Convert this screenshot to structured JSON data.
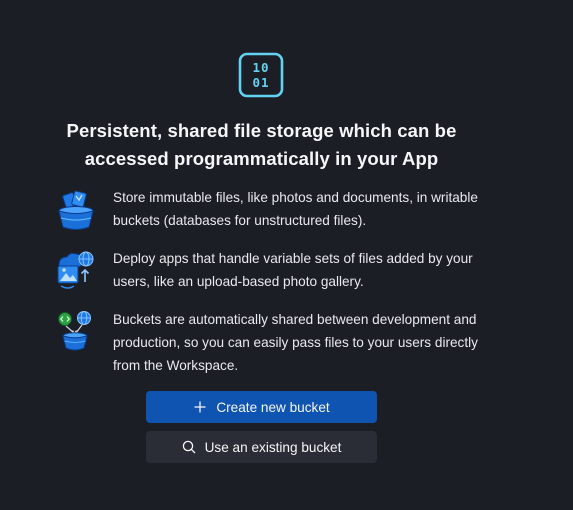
{
  "hero": {
    "icon": "binary-storage-icon",
    "glyph_rows": [
      "10",
      "01"
    ],
    "accent_color": "#62d2f1"
  },
  "title": "Persistent, shared file storage which can be accessed programmatically in your App",
  "features": [
    {
      "icon": "bucket-files-icon",
      "text": "Store immutable files, like photos and documents, in writable buckets (databases for unstructured files)."
    },
    {
      "icon": "upload-gallery-icon",
      "text": "Deploy apps that handle variable sets of files added by your users, like an upload-based photo gallery."
    },
    {
      "icon": "shared-bucket-icon",
      "text": "Buckets are automatically shared between development and production, so you can easily pass files to your users directly from the Workspace."
    }
  ],
  "actions": {
    "create_label": "Create new bucket",
    "existing_label": "Use an existing bucket"
  },
  "colors": {
    "background": "#1c1e26",
    "primary_button": "#0f54b0",
    "secondary_button": "#2b2d36",
    "icon_blue": "#1f7ae8",
    "icon_green": "#3fb950"
  }
}
